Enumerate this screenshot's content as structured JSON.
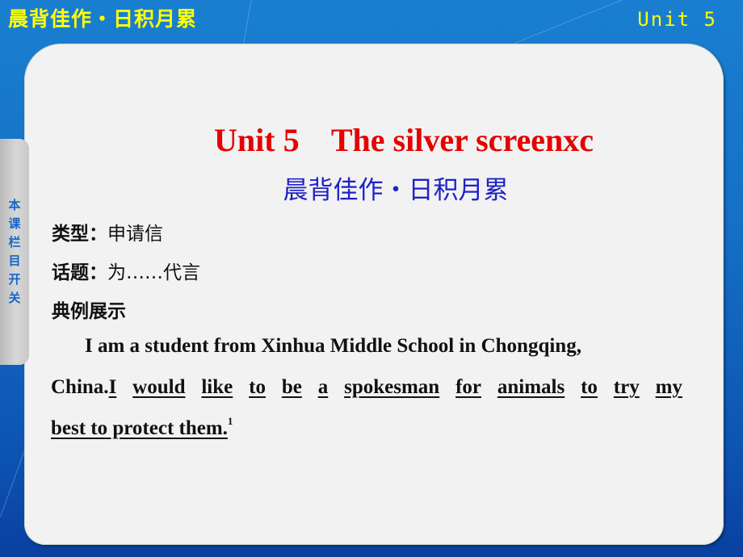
{
  "header": {
    "section_title": "晨背佳作・日积月累",
    "unit_label": "Unit 5"
  },
  "sidebar": {
    "toggle_label_chars": [
      "本",
      "课",
      "栏",
      "目",
      "开",
      "关"
    ]
  },
  "slide": {
    "title_en": "Unit 5    The silver screenxc",
    "title_cn": "晨背佳作・日积月累",
    "meta": [
      {
        "label": "类型：",
        "value": "申请信"
      },
      {
        "label": "话题：",
        "value": "为……代言"
      },
      {
        "label": "典例展示",
        "value": ""
      }
    ],
    "paragraph": {
      "line1": "I am a student from Xinhua Middle School in Chongqing,",
      "line2_plain": "China.",
      "line2_underlined_words": [
        "I",
        "would",
        "like",
        "to",
        "be",
        "a",
        "spokesman",
        "for",
        "animals",
        "to",
        "try",
        "my"
      ],
      "line3_underlined": "best to protect them.",
      "footnote": "1"
    }
  },
  "colors": {
    "header_text": "#ffff00",
    "title_en": "#e60000",
    "title_cn": "#1e22c8",
    "sidebar_text": "#1664c8",
    "panel_bg": "#f2f2f2"
  }
}
